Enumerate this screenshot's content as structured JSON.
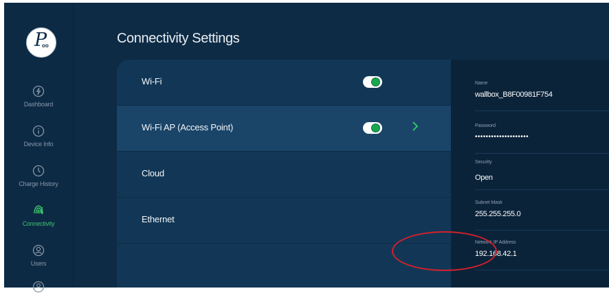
{
  "sidebar": {
    "items": [
      {
        "label": "Dashboard",
        "icon": "lightning-icon"
      },
      {
        "label": "Device Info",
        "icon": "info-icon"
      },
      {
        "label": "Charge History",
        "icon": "clock-icon"
      },
      {
        "label": "Connectivity",
        "icon": "signal-icon"
      },
      {
        "label": "Users",
        "icon": "user-icon"
      }
    ],
    "active": "Connectivity"
  },
  "header": {
    "title": "Connectivity Settings"
  },
  "connectivity": {
    "items": [
      {
        "label": "Wi-Fi",
        "toggle": "on"
      },
      {
        "label": "Wi-Fi AP (Access Point)",
        "toggle": "on",
        "selected": true
      },
      {
        "label": "Cloud"
      },
      {
        "label": "Ethernet"
      }
    ]
  },
  "details": {
    "name_label": "Name",
    "name_value": "wallbox_B8F00981F754",
    "password_label": "Password",
    "password_value": "••••••••••••••••••••",
    "security_label": "Security",
    "security_value": "Open",
    "subnet_label": "Subnet Mask",
    "subnet_value": "255.255.255.0",
    "ip_label": "Network IP Address",
    "ip_value": "192.168.42.1"
  },
  "colors": {
    "background": "#0d2b45",
    "accent_green": "#3cc26f",
    "annotation_red": "#d8202a"
  }
}
